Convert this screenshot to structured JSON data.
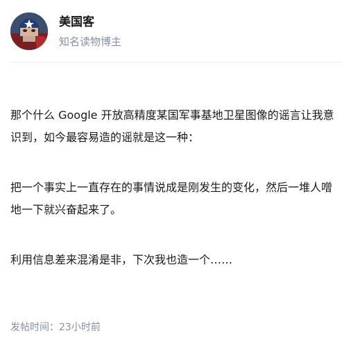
{
  "author": {
    "name": "美国客",
    "badge": "知名读物博主",
    "avatar_icon": "captain-america-avatar"
  },
  "post": {
    "paragraphs": [
      "那个什么 Google 开放高精度某国军事基地卫星图像的谣言让我意识到，如今最容易造的谣就是这一种：",
      "把一个事实上一直存在的事情说成是刚发生的变化，然后一堆人噌地一下就兴奋起来了。",
      "利用信息差来混淆是非，下次我也造一个……"
    ],
    "time_label": "发帖时间：",
    "time_value": "23小时前"
  }
}
